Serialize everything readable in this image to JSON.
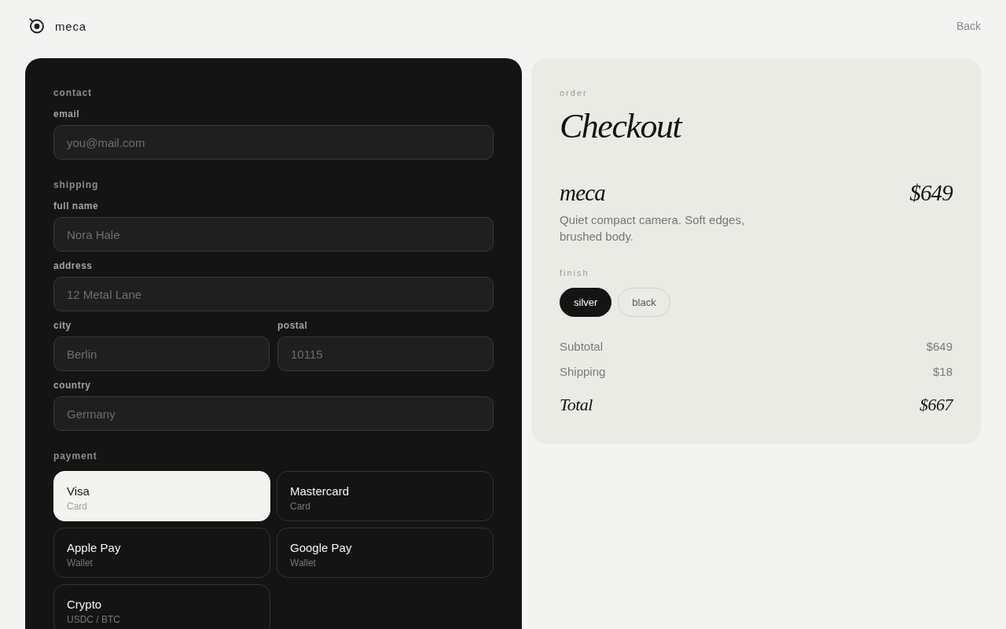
{
  "header": {
    "brand": "meca",
    "back_link": "Back"
  },
  "checkout_form": {
    "sections": [
      {
        "title": "contact",
        "rows": [
          [
            {
              "label": "email",
              "placeholder": "you@mail.com"
            }
          ]
        ]
      },
      {
        "title": "shipping",
        "rows": [
          [
            {
              "label": "full name",
              "placeholder": "Nora Hale"
            }
          ],
          [
            {
              "label": "address",
              "placeholder": "12 Metal Lane"
            }
          ],
          [
            {
              "label": "city",
              "placeholder": "Berlin"
            },
            {
              "label": "postal",
              "placeholder": "10115"
            }
          ],
          [
            {
              "label": "country",
              "placeholder": "Germany"
            }
          ]
        ]
      }
    ],
    "payment": {
      "title": "payment",
      "methods": [
        {
          "name": "Visa",
          "type": "Card",
          "selected": true
        },
        {
          "name": "Mastercard",
          "type": "Card",
          "selected": false
        },
        {
          "name": "Apple Pay",
          "type": "Wallet",
          "selected": false
        },
        {
          "name": "Google Pay",
          "type": "Wallet",
          "selected": false
        },
        {
          "name": "Crypto",
          "type": "USDC / BTC",
          "selected": false
        }
      ]
    }
  },
  "order_summary": {
    "eyebrow": "order",
    "title": "Checkout",
    "product": {
      "name": "meca",
      "price": "$649",
      "description": "Quiet compact camera. Soft edges, brushed body."
    },
    "finish": {
      "label": "finish",
      "options": [
        {
          "label": "silver",
          "selected": true
        },
        {
          "label": "black",
          "selected": false
        }
      ]
    },
    "lines": [
      {
        "label": "Subtotal",
        "amount": "$649"
      },
      {
        "label": "Shipping",
        "amount": "$18"
      }
    ],
    "total": {
      "label": "Total",
      "amount": "$667"
    }
  }
}
